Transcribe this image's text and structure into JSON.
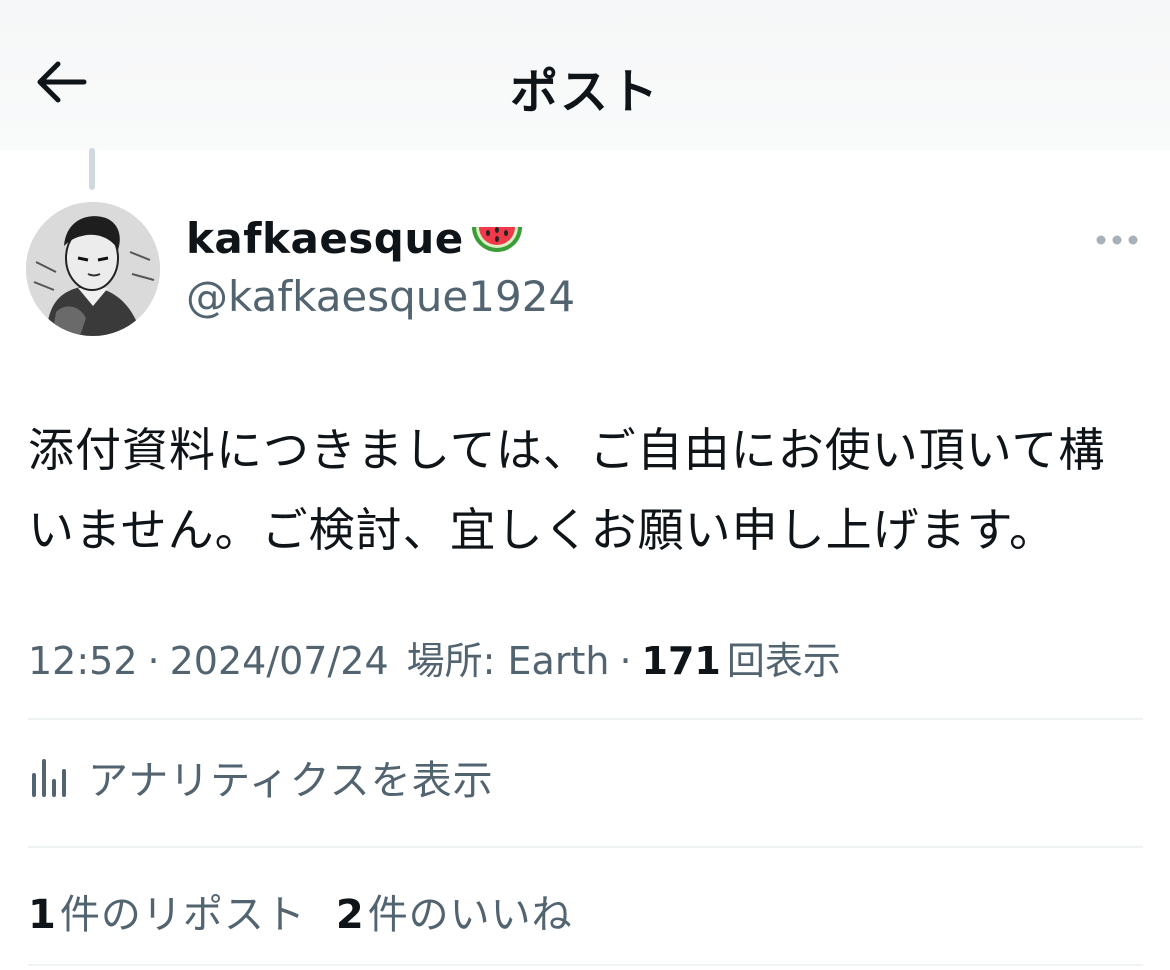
{
  "header": {
    "title": "ポスト"
  },
  "author": {
    "display_name": "kafkaesque",
    "handle": "@kafkaesque1924",
    "name_emoji": "watermelon"
  },
  "post": {
    "text": "添付資料につきましては、ご自由にお使い頂いて構いません。ご検討、宜しくお願い申し上げます。"
  },
  "meta": {
    "time": "12:52",
    "date": "2024/07/24",
    "location": "場所: Earth",
    "views_count": "171",
    "views_label": "回表示"
  },
  "analytics": {
    "label": "アナリティクスを表示"
  },
  "stats": {
    "reposts_count": "1",
    "reposts_label": "件のリポスト",
    "likes_count": "2",
    "likes_label": "件のいいね"
  },
  "colors": {
    "text": "#0f1419",
    "secondary": "#536471",
    "divider": "#eff3f4"
  }
}
